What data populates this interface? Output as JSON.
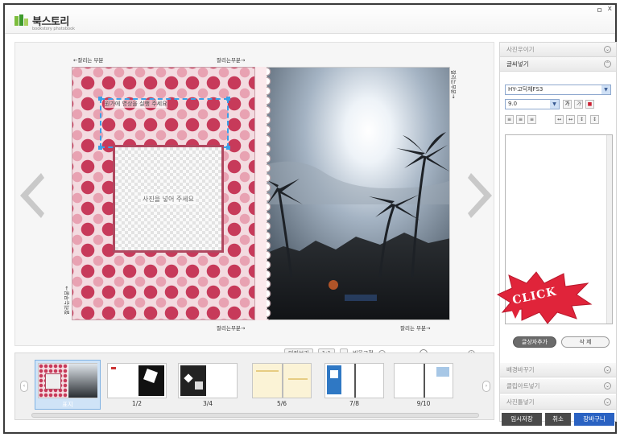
{
  "app": {
    "logo_text": "북스토리",
    "logo_sub": "bookstory photobook",
    "minimize": "ㅁ",
    "close": "x"
  },
  "editor": {
    "left_page": {
      "top_edge": "←잘리는 부분",
      "top_right_edge": "잘리는부분→",
      "side_edge": "잘리는부분→",
      "bottom_right_edge": "잘리는부분→",
      "text_hint": "원가에 영상을 실행 주세요",
      "photo_placeholder": "사진을 넣어 주세요"
    },
    "right_page": {
      "side_edge": "잘리는부분→",
      "bottom_edge": "잘리는 부분→"
    },
    "zoom": {
      "preview_label": "미리보기",
      "value": "1:1",
      "ratio_fix_label": "비율고정",
      "slider_level": 0.45
    }
  },
  "thumbnails": [
    {
      "label": "표지",
      "selected": true
    },
    {
      "label": "1/2",
      "selected": false
    },
    {
      "label": "3/4",
      "selected": false
    },
    {
      "label": "5/6",
      "selected": false
    },
    {
      "label": "7/8",
      "selected": false
    },
    {
      "label": "9/10",
      "selected": false
    }
  ],
  "panel": {
    "sections": {
      "photo_insert": "사진우이기",
      "text_insert": "글씨넣기",
      "background": "배경바꾸기",
      "clipart": "클립아트넣기",
      "frame": "사진틀넣기"
    },
    "font_select": "HY-고딕체FS3",
    "size_select": "9.0",
    "style_buttons": [
      "가",
      "가",
      "■"
    ],
    "text_value": "",
    "add_text_button": "글상자추가",
    "delete_button": "삭 제",
    "click_callout": "CLICK",
    "bottom_buttons": {
      "temp_save": "임시저장",
      "cancel": "취소",
      "cart": "장바구니"
    }
  },
  "colors": {
    "accent_blue": "#3a6fc9",
    "cart_blue": "#2a62c2",
    "burst_red": "#e0243a",
    "polka": "#c73a5a"
  }
}
